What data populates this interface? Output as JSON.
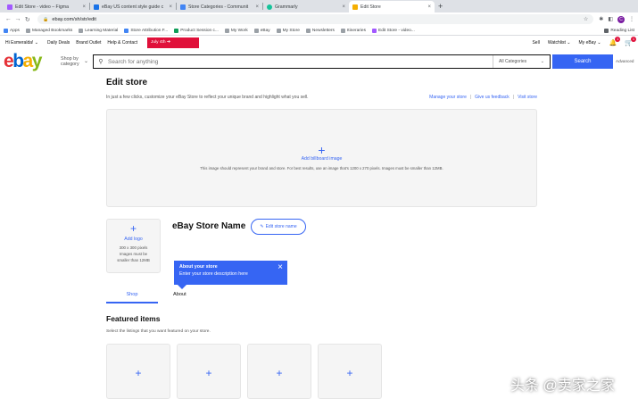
{
  "browser": {
    "tabs": [
      {
        "title": "Edit Store - video – Figma",
        "color": "#a259ff"
      },
      {
        "title": "eBay US content style guide c",
        "color": "#1a73e8"
      },
      {
        "title": "Store Categories - Communit",
        "color": "#4285f4"
      },
      {
        "title": "Grammarly",
        "color": "#15c39a"
      },
      {
        "title": "Edit Store",
        "color": "#f5af02"
      }
    ],
    "url": "ebay.com/sh/str/edit",
    "bookmarks": [
      "Apps",
      "Managed Bookmarks",
      "Learning Material",
      "Store Attribution F...",
      "Product Session c...",
      "My Work",
      "eBay",
      "My Store",
      "Newsletters",
      "Itineraries",
      "Edit Store - video..."
    ],
    "reading_list": "Reading List",
    "profile_initial": "C"
  },
  "ebay_header": {
    "greeting": "Hi Esmeralda!",
    "links": [
      "Daily Deals",
      "Brand Outlet",
      "Help & Contact"
    ],
    "promo": "July 4th",
    "right_links": [
      "Sell",
      "Watchlist",
      "My eBay"
    ],
    "notif_count": "1",
    "cart_count": "1"
  },
  "search": {
    "logo": {
      "e": "e",
      "b": "b",
      "a": "a",
      "y": "y"
    },
    "shop_by_1": "Shop by",
    "shop_by_2": "category",
    "placeholder": "Search for anything",
    "category": "All Categories",
    "button": "Search",
    "advanced": "Advanced"
  },
  "page": {
    "title": "Edit store",
    "subtitle": "In just a few clicks, customize your eBay Store to reflect your unique brand and highlight what you sell.",
    "links": [
      "Manage your store",
      "Give us feedback",
      "Visit store"
    ],
    "billboard": {
      "add_label": "Add billboard image",
      "hint": "This image should represent your brand and store. For best results, use an image that's 1200 x 270 pixels. Images must be smaller than 12MB."
    },
    "logo": {
      "add_label": "Add logo",
      "hint": "300 x 300 pixels Images must be smaller than 12MB"
    },
    "store_name": "eBay Store Name",
    "edit_store_name": "Edit store name",
    "tooltip": {
      "title": "About your store",
      "text": "Enter your store description here"
    },
    "tabs": [
      "Shop",
      "About"
    ],
    "featured": {
      "title": "Featured items",
      "subtitle": "Select the listings that you want featured on your store."
    }
  },
  "watermark": "头条 @卖家之家",
  "colors": {
    "accent": "#3665f3",
    "promo": "#e0103a"
  }
}
